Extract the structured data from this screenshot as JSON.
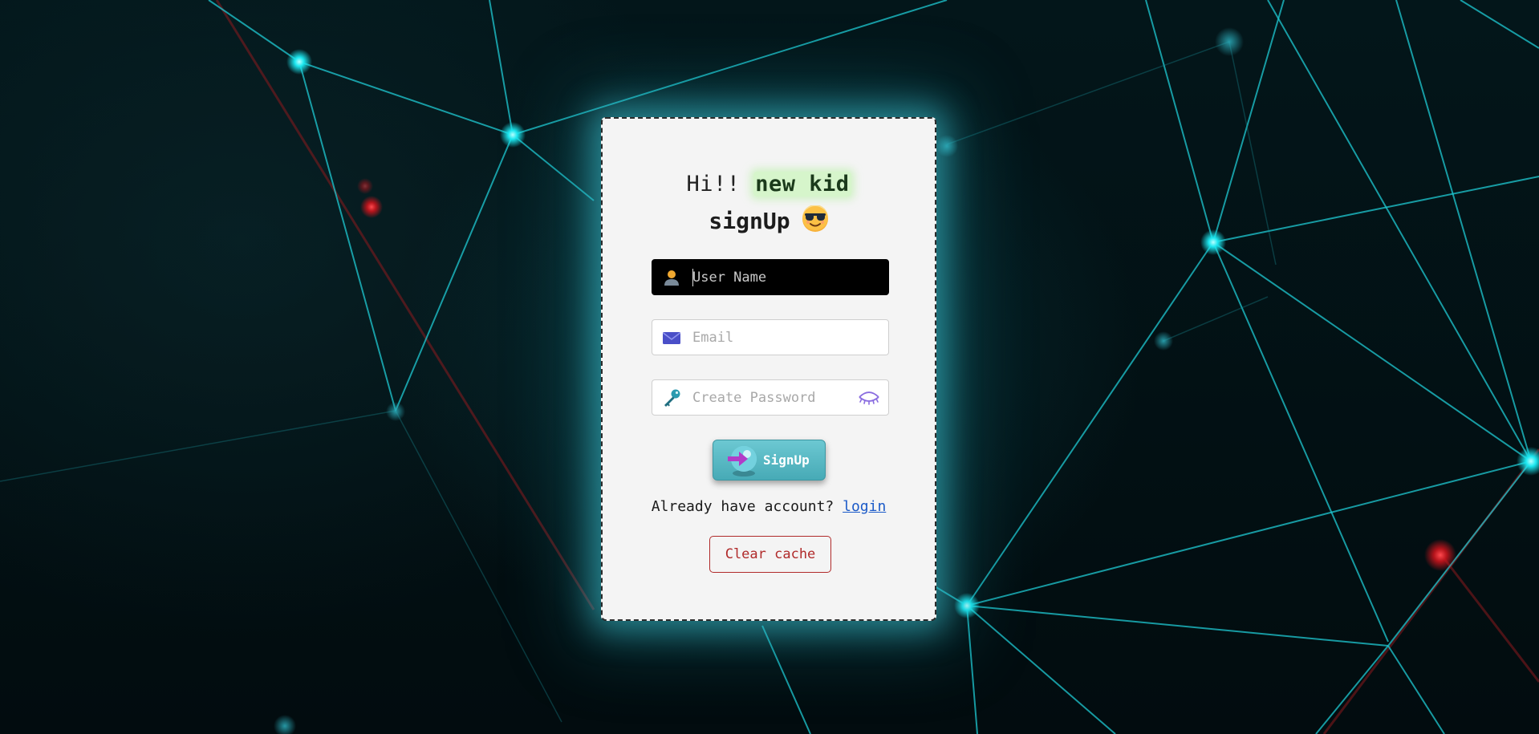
{
  "greeting": {
    "prefix": "Hi!! ",
    "highlight": "new kid",
    "title": "signUp",
    "emoji_icon": "smiling-face-with-sunglasses-icon"
  },
  "form": {
    "username": {
      "placeholder": "User Name",
      "value": "",
      "icon": "user-icon"
    },
    "email": {
      "placeholder": "Email",
      "value": "",
      "icon": "envelope-icon"
    },
    "password": {
      "placeholder": "Create Password",
      "value": "",
      "icon": "key-icon",
      "toggle_icon": "eye-closed-icon"
    }
  },
  "signup_button": {
    "label": "SignUp",
    "icon": "arrow-right-icon"
  },
  "login_prompt": {
    "text": "Already have account? ",
    "link_label": "login"
  },
  "clear_cache_button": {
    "label": "Clear cache"
  },
  "colors": {
    "accent_glow": "#40c8d7",
    "card_background": "#f4f4f4",
    "signup_button": "#47aab6",
    "link": "#1b5ac8",
    "danger": "#b02a2a",
    "node": "#11e8f0",
    "node_red": "#e0262f"
  }
}
